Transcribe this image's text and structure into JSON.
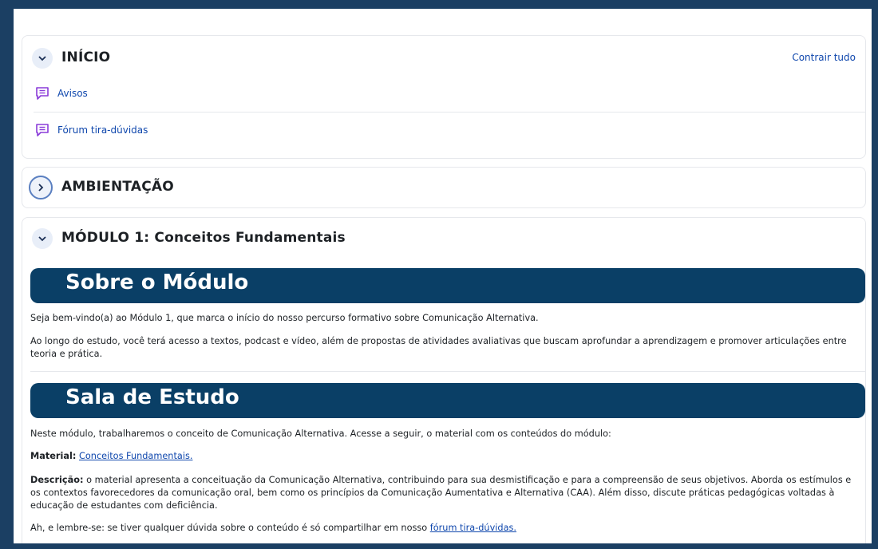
{
  "sections": {
    "inicio": {
      "title": "INÍCIO",
      "collapse_all": "Contrair tudo",
      "activities": [
        {
          "label": "Avisos",
          "icon": "forum-icon"
        },
        {
          "label": "Fórum tira-dúvidas",
          "icon": "forum-icon"
        }
      ]
    },
    "ambientacao": {
      "title": "AMBIENTAÇÃO"
    },
    "modulo1": {
      "title": "MÓDULO 1: Conceitos Fundamentais",
      "sobre": {
        "banner": "Sobre o Módulo",
        "p1": "Seja bem-vindo(a) ao Módulo 1, que marca o início do nosso percurso formativo sobre Comunicação Alternativa.",
        "p2": "Ao longo do estudo, você terá acesso a textos, podcast e vídeo, além de propostas de atividades avaliativas que buscam aprofundar a aprendizagem e promover articulações entre teoria e prática."
      },
      "sala": {
        "banner": "Sala de Estudo",
        "p1": "Neste módulo, trabalharemos o conceito de Comunicação Alternativa. Acesse a seguir, o material com os conteúdos do módulo:",
        "material_label": "Material:",
        "material_link": "Conceitos Fundamentais.",
        "descricao_label": "Descrição:",
        "descricao_text": " o material apresenta a conceituação da Comunicação Alternativa, contribuindo para sua desmistificação e para a compreensão de seus objetivos. Aborda os estímulos e os contextos favorecedores da comunicação oral, bem como os princípios da Comunicação Aumentativa e Alternativa (CAA). Além disso, discute práticas pedagógicas voltadas à educação de estudantes com deficiência.",
        "lembre_text": "Ah, e lembre-se: se tiver qualquer dúvida sobre o conteúdo é só compartilhar em nosso ",
        "lembre_link": "fórum tira-dúvidas."
      }
    }
  },
  "colors": {
    "outer_frame": "#1b3f63",
    "banner": "#0a3f66",
    "link": "#0f47ad",
    "activity_icon": "#8a3bd9"
  }
}
